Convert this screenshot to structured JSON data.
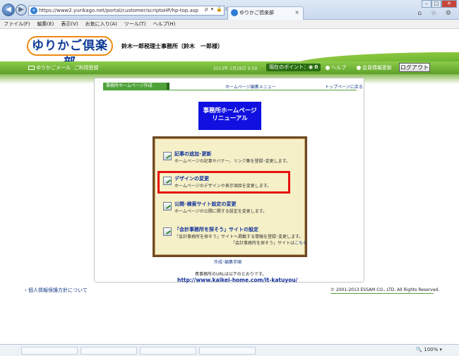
{
  "browser": {
    "address": "https://www2.yurikago.net/portal/customer/scriptsHP/hp-top.asp",
    "address_tools": "ρ ▾ 🔒 ⟳ ✕",
    "tab_title": "ゆりかご倶楽部",
    "tab_close": "×",
    "back": "◀",
    "forward": "▶",
    "win_min": "–",
    "win_max": "□",
    "win_close": "✕",
    "chrome_icons": "⌂ ☆ ⚙",
    "zoom": "🔍 100%  ▾"
  },
  "menubar": {
    "items": [
      "ファイル(F)",
      "編集(E)",
      "表示(V)",
      "お気に入り(A)",
      "ツール(T)",
      "ヘルプ(H)"
    ]
  },
  "header": {
    "logo": "ゆりかご倶楽部",
    "greeting": "鈴木一郎税理士事務所（鈴木　一郎様）"
  },
  "greenbar": {
    "mail_link": "ゆりかごメール",
    "usage_link": "ご利用登録",
    "login_date": "2013年 2月28日 9:59",
    "points_label": "現在のポイント：",
    "points_value": "0",
    "help": "ヘルプ",
    "info_update": "会員情報更新",
    "logout": "ログアウト"
  },
  "panel": {
    "tab_label": "事務所ホームページ作成",
    "menu_link": "ホームページ編集メニュー",
    "top_link": "トップページに戻る",
    "title_line1": "事務所ホームページ",
    "title_line2": "リニューアル",
    "items": [
      {
        "title": "記事の追加･更新",
        "desc": "ホームページの記事やバナー、リンク集を登録･変更します。"
      },
      {
        "title": "デザインの変更",
        "desc": "ホームページのデザインや表示項目を変更します。"
      },
      {
        "title": "公開･検索サイト設定の変更",
        "desc": "ホームページの公開に関する設定を変更します。"
      },
      {
        "title": "「会計事務所を探そう」サイトの設定",
        "desc": "「会計事務所を探そう」サイトへ掲載する情報を登録･変更します。",
        "sub_text": "「会計事務所を探そう」サイトは",
        "sub_link": "こちら"
      }
    ],
    "guide_link": "作成･編集手順",
    "url_note": "貴事務所のURLは以下のとおりです。",
    "url": "http://www.kaikei-home.com/it-katuyou/"
  },
  "footer": {
    "privacy": "個人情報保護方針について",
    "copyright": "© 2001-2013 ESSAM CO., LTD. All Rights Reserved."
  }
}
